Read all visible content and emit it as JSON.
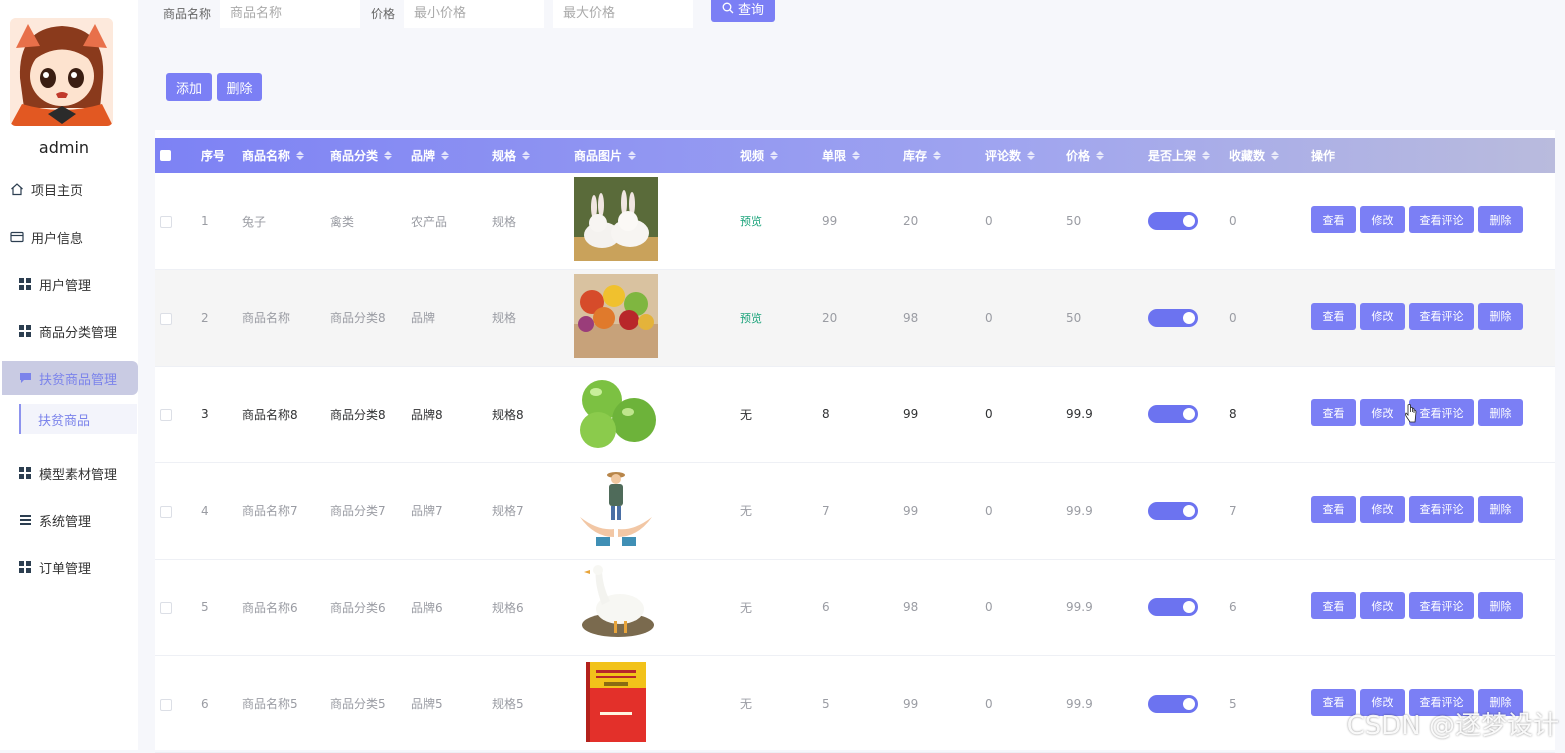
{
  "user": {
    "name": "admin"
  },
  "menu": {
    "home": "项目主页",
    "user_info": "用户信息",
    "items": [
      "用户管理",
      "商品分类管理",
      "扶贫商品管理",
      "模型素材管理",
      "系统管理",
      "订单管理"
    ],
    "active_item": "扶贫商品管理",
    "active_sub": "扶贫商品"
  },
  "search": {
    "name_label": "商品名称",
    "name_placeholder": "商品名称",
    "price_label": "价格",
    "min_placeholder": "最小价格",
    "max_placeholder": "最大价格",
    "query_label": "查询"
  },
  "actions": {
    "add": "添加",
    "delete": "删除"
  },
  "table": {
    "columns": [
      "序号",
      "商品名称",
      "商品分类",
      "品牌",
      "规格",
      "商品图片",
      "视频",
      "单限",
      "库存",
      "评论数",
      "价格",
      "是否上架",
      "收藏数",
      "操作"
    ],
    "op_buttons": [
      "查看",
      "修改",
      "查看评论",
      "删除"
    ],
    "rows": [
      {
        "no": "1",
        "name": "兔子",
        "category": "禽类",
        "brand": "农产品",
        "spec": "规格",
        "image": "rabbits",
        "video": "预览",
        "limit": "99",
        "stock": "20",
        "comments": "0",
        "price": "50",
        "on_sale": true,
        "favorites": "0"
      },
      {
        "no": "2",
        "name": "商品名称",
        "category": "商品分类8",
        "brand": "品牌",
        "spec": "规格",
        "image": "fruits",
        "video": "预览",
        "limit": "20",
        "stock": "98",
        "comments": "0",
        "price": "50",
        "on_sale": true,
        "favorites": "0"
      },
      {
        "no": "3",
        "name": "商品名称8",
        "category": "商品分类8",
        "brand": "品牌8",
        "spec": "规格8",
        "image": "green-apples",
        "video": "无",
        "limit": "8",
        "stock": "99",
        "comments": "0",
        "price": "99.9",
        "on_sale": true,
        "favorites": "8"
      },
      {
        "no": "4",
        "name": "商品名称7",
        "category": "商品分类7",
        "brand": "品牌7",
        "spec": "规格7",
        "image": "farmer-in-hands",
        "video": "无",
        "limit": "7",
        "stock": "99",
        "comments": "0",
        "price": "99.9",
        "on_sale": true,
        "favorites": "7"
      },
      {
        "no": "5",
        "name": "商品名称6",
        "category": "商品分类6",
        "brand": "品牌6",
        "spec": "规格6",
        "image": "goose",
        "video": "无",
        "limit": "6",
        "stock": "98",
        "comments": "0",
        "price": "99.9",
        "on_sale": true,
        "favorites": "6"
      },
      {
        "no": "6",
        "name": "商品名称5",
        "category": "商品分类5",
        "brand": "品牌5",
        "spec": "规格5",
        "image": "book",
        "video": "无",
        "limit": "5",
        "stock": "99",
        "comments": "0",
        "price": "99.9",
        "on_sale": true,
        "favorites": "5"
      }
    ]
  },
  "watermark": "CSDN @逐梦设计",
  "colors": {
    "primary": "#7b7ff5",
    "switch": "#6c73f0",
    "preview": "#1aa37a"
  }
}
